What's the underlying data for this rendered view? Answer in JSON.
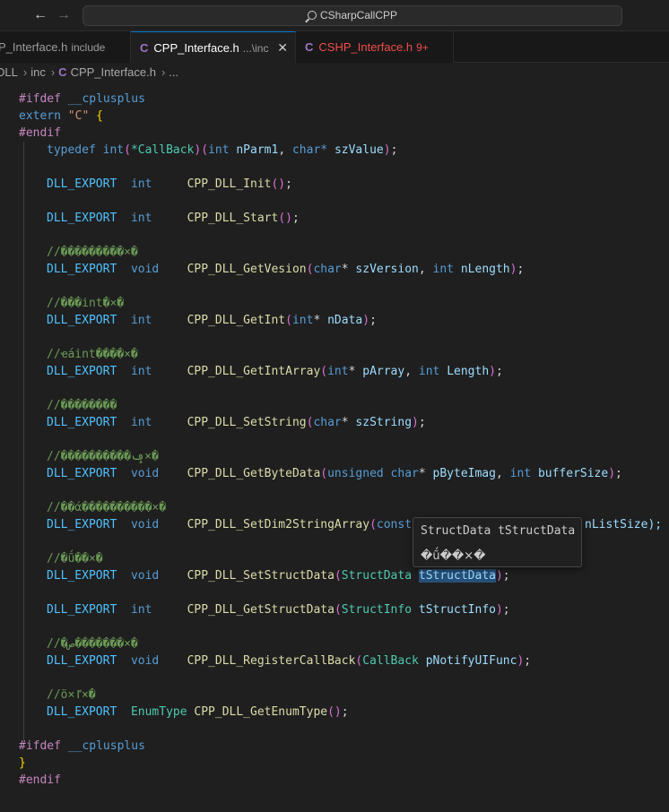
{
  "title_bar": {
    "back_glyph": "←",
    "forward_glyph": "→",
    "search_text": "CSharpCallCPP"
  },
  "tabs": [
    {
      "label": "P_Interface.h",
      "description": "include"
    },
    {
      "label": "CPP_Interface.h",
      "description": "...\\inc",
      "close_glyph": "✕"
    },
    {
      "label": "CSHP_Interface.h",
      "badge": "9+"
    }
  ],
  "tab_icon_letter": "C",
  "breadcrumb": {
    "items": [
      "DLL",
      "inc",
      "CPP_Interface.h",
      "..."
    ]
  },
  "code": {
    "ifdef": "#ifdef",
    "cplusplus": "__cplusplus",
    "extern": "extern",
    "extern_c": "\"C\"",
    "brace_open": "{",
    "brace_close": "}",
    "endif": "#endif",
    "typedef_line": {
      "typedef": "typedef",
      "int": "int",
      "name": "*CallBack",
      "p1_type": "int",
      "p1": "nParm1",
      "p2_type": "char*",
      "p2": "szValue"
    },
    "export": "DLL_EXPORT",
    "lines": [
      {
        "ret": "int",
        "fn": "CPP_DLL_Init",
        "args": "()"
      },
      {
        "ret": "int",
        "fn": "CPP_DLL_Start",
        "args": "()"
      },
      {
        "comment": "//���������×�",
        "ret": "void",
        "fn": "CPP_DLL_GetVesion",
        "args_html": "char* szVersion, int nLength"
      },
      {
        "comment": "//���int�×�",
        "ret": "int",
        "fn": "CPP_DLL_GetInt",
        "args_html": "int* nData"
      },
      {
        "comment": "//ҽáint����×�",
        "ret": "int",
        "fn": "CPP_DLL_GetIntArray",
        "args_html": "int* pArray, int Length"
      },
      {
        "comment": "//��������",
        "ret": "int",
        "fn": "CPP_DLL_SetString",
        "args_html": "char* szString"
      },
      {
        "comment": "//����������ݡ×�",
        "ret": "void",
        "fn": "CPP_DLL_GetByteData",
        "args_html": "unsigned char* pByteImag, int bufferSize"
      },
      {
        "comment": "//��ά����������×�",
        "ret": "void",
        "fn": "CPP_DLL_SetDim2StringArray",
        "args_html": "const",
        "tail": "nListSize);"
      },
      {
        "comment": "//�ṹ��×�",
        "ret": "void",
        "fn": "CPP_DLL_SetStructData",
        "args_html": "StructData tStructData"
      },
      {
        "ret": "int",
        "fn": "CPP_DLL_GetStructData",
        "args_html": "StructInfo tStructInfo"
      },
      {
        "comment": "//�ص�������×�",
        "ret": "void",
        "fn": "CPP_DLL_RegisterCallBack",
        "args_html": "CallBack pNotifyUIFunc"
      },
      {
        "comment": "//ö×ٵ×�",
        "ret": "EnumType",
        "fn": "CPP_DLL_GetEnumType",
        "args": "()"
      }
    ]
  },
  "hover": {
    "signature": "StructData tStructData",
    "doc": "�ṹ��×�"
  }
}
